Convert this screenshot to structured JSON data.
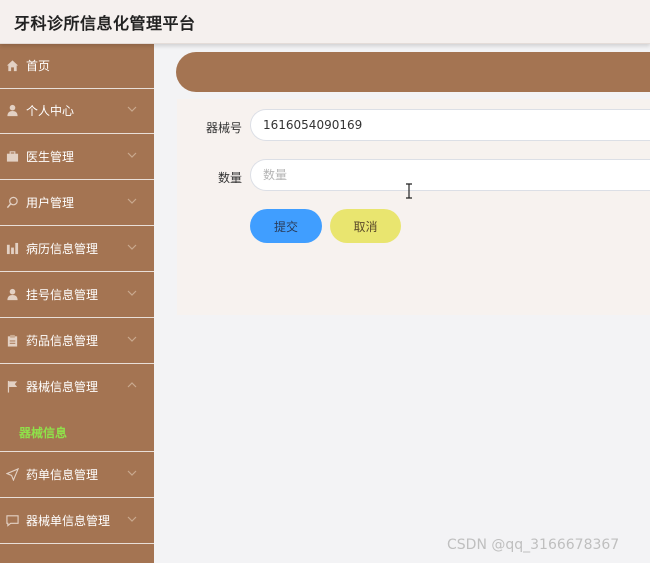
{
  "app": {
    "title": "牙科诊所信息化管理平台"
  },
  "sidebar": {
    "items": [
      {
        "label": "首页",
        "icon": "home-icon",
        "has_chevron": false
      },
      {
        "label": "个人中心",
        "icon": "user-icon",
        "has_chevron": true
      },
      {
        "label": "医生管理",
        "icon": "briefcase-icon",
        "has_chevron": true
      },
      {
        "label": "用户管理",
        "icon": "user-search-icon",
        "has_chevron": true
      },
      {
        "label": "病历信息管理",
        "icon": "chart-icon",
        "has_chevron": true
      },
      {
        "label": "挂号信息管理",
        "icon": "user-icon",
        "has_chevron": true
      },
      {
        "label": "药品信息管理",
        "icon": "clipboard-icon",
        "has_chevron": true
      },
      {
        "label": "器械信息管理",
        "icon": "flag-icon",
        "has_chevron": true,
        "expanded": true
      },
      {
        "label": "药单信息管理",
        "icon": "send-icon",
        "has_chevron": true
      },
      {
        "label": "器械单信息管理",
        "icon": "message-icon",
        "has_chevron": true
      }
    ],
    "submenu": {
      "label": "器械信息",
      "active_color": "#8fe04a"
    }
  },
  "form": {
    "fields": [
      {
        "label": "器械号",
        "value": "1616054090169",
        "placeholder": ""
      },
      {
        "label": "数量",
        "value": "",
        "placeholder": "数量"
      }
    ],
    "submit_label": "提交",
    "cancel_label": "取消"
  },
  "watermark": "CSDN @qq_3166678367",
  "colors": {
    "sidebar_bg": "#a47452",
    "header_pill": "#a47452",
    "submit": "#409eff",
    "cancel": "#e9e56f"
  }
}
